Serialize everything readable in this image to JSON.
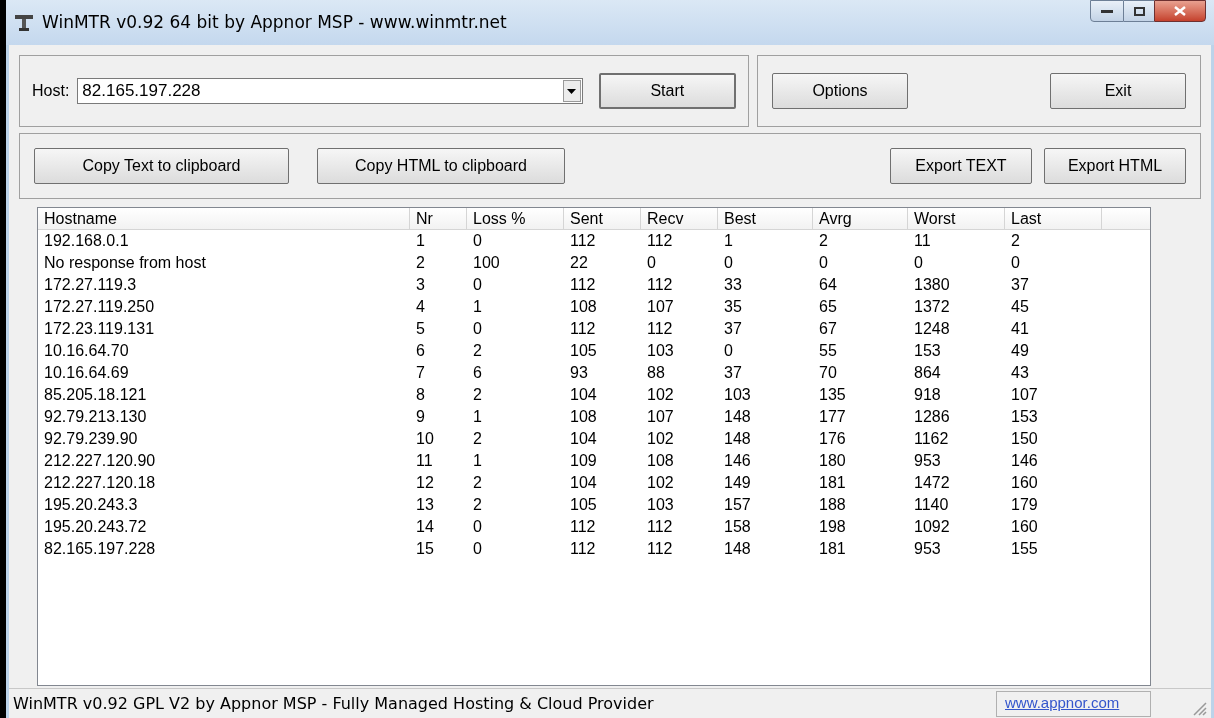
{
  "window": {
    "title": "WinMTR v0.92 64 bit by Appnor MSP - www.winmtr.net"
  },
  "host": {
    "label": "Host:",
    "value": "82.165.197.228"
  },
  "start_button": "Start",
  "options_button": "Options",
  "exit_button": "Exit",
  "copy_buttons": [
    "Copy Text to clipboard",
    "Copy HTML to clipboard"
  ],
  "export_buttons": [
    "Export TEXT",
    "Export HTML"
  ],
  "table": {
    "columns": [
      "Hostname",
      "Nr",
      "Loss %",
      "Sent",
      "Recv",
      "Best",
      "Avrg",
      "Worst",
      "Last"
    ],
    "rows": [
      [
        "192.168.0.1",
        "1",
        "0",
        "112",
        "112",
        "1",
        "2",
        "11",
        "2"
      ],
      [
        "No response from host",
        "2",
        "100",
        "22",
        "0",
        "0",
        "0",
        "0",
        "0"
      ],
      [
        "172.27.119.3",
        "3",
        "0",
        "112",
        "112",
        "33",
        "64",
        "1380",
        "37"
      ],
      [
        "172.27.119.250",
        "4",
        "1",
        "108",
        "107",
        "35",
        "65",
        "1372",
        "45"
      ],
      [
        "172.23.119.131",
        "5",
        "0",
        "112",
        "112",
        "37",
        "67",
        "1248",
        "41"
      ],
      [
        "10.16.64.70",
        "6",
        "2",
        "105",
        "103",
        "0",
        "55",
        "153",
        "49"
      ],
      [
        "10.16.64.69",
        "7",
        "6",
        "93",
        "88",
        "37",
        "70",
        "864",
        "43"
      ],
      [
        "85.205.18.121",
        "8",
        "2",
        "104",
        "102",
        "103",
        "135",
        "918",
        "107"
      ],
      [
        "92.79.213.130",
        "9",
        "1",
        "108",
        "107",
        "148",
        "177",
        "1286",
        "153"
      ],
      [
        "92.79.239.90",
        "10",
        "2",
        "104",
        "102",
        "148",
        "176",
        "1162",
        "150"
      ],
      [
        "212.227.120.90",
        "11",
        "1",
        "109",
        "108",
        "146",
        "180",
        "953",
        "146"
      ],
      [
        "212.227.120.18",
        "12",
        "2",
        "104",
        "102",
        "149",
        "181",
        "1472",
        "160"
      ],
      [
        "195.20.243.3",
        "13",
        "2",
        "105",
        "103",
        "157",
        "188",
        "1140",
        "179"
      ],
      [
        "195.20.243.72",
        "14",
        "0",
        "112",
        "112",
        "158",
        "198",
        "1092",
        "160"
      ],
      [
        "82.165.197.228",
        "15",
        "0",
        "112",
        "112",
        "148",
        "181",
        "953",
        "155"
      ]
    ]
  },
  "status_bar": {
    "text": "WinMTR v0.92 GPL V2 by Appnor MSP - Fully Managed Hosting & Cloud Provider",
    "link": "www.appnor.com"
  }
}
